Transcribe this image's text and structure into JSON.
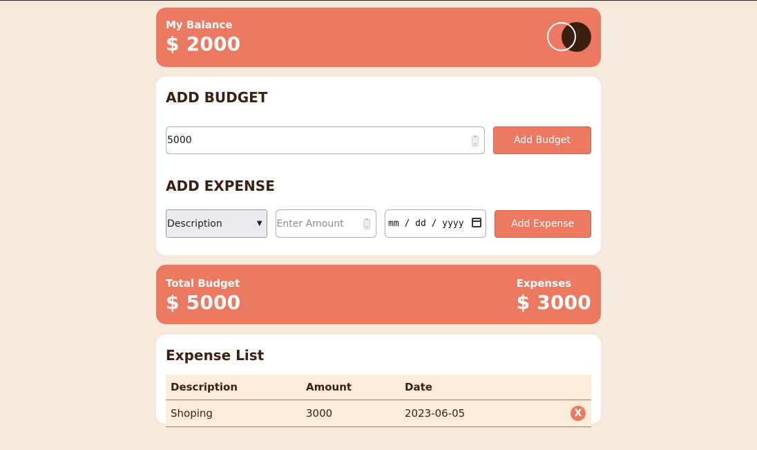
{
  "balance": {
    "label": "My Balance",
    "amount": "$ 2000",
    "card_icon": "mastercard-icon"
  },
  "add_budget": {
    "title": "ADD BUDGET",
    "input_value": "5000",
    "button_label": "Add Budget"
  },
  "add_expense": {
    "title": "ADD EXPENSE",
    "description_select": "Description",
    "amount_placeholder": "Enter Amount",
    "date_placeholder": "mm / dd / yyyy",
    "button_label": "Add Expense"
  },
  "totals": {
    "budget_label": "Total Budget",
    "budget_amount": "$ 5000",
    "expenses_label": "Expenses",
    "expenses_amount": "$ 3000"
  },
  "expense_list": {
    "title": "Expense List",
    "columns": [
      "Description",
      "Amount",
      "Date"
    ],
    "rows": [
      {
        "description": "Shoping",
        "amount": "3000",
        "date": "2023-06-05",
        "delete_label": "X"
      }
    ]
  },
  "colors": {
    "accent": "#ec7a63",
    "background": "#f7e8dc",
    "text_dark": "#3b1f10",
    "table_row": "#fcebd7"
  }
}
